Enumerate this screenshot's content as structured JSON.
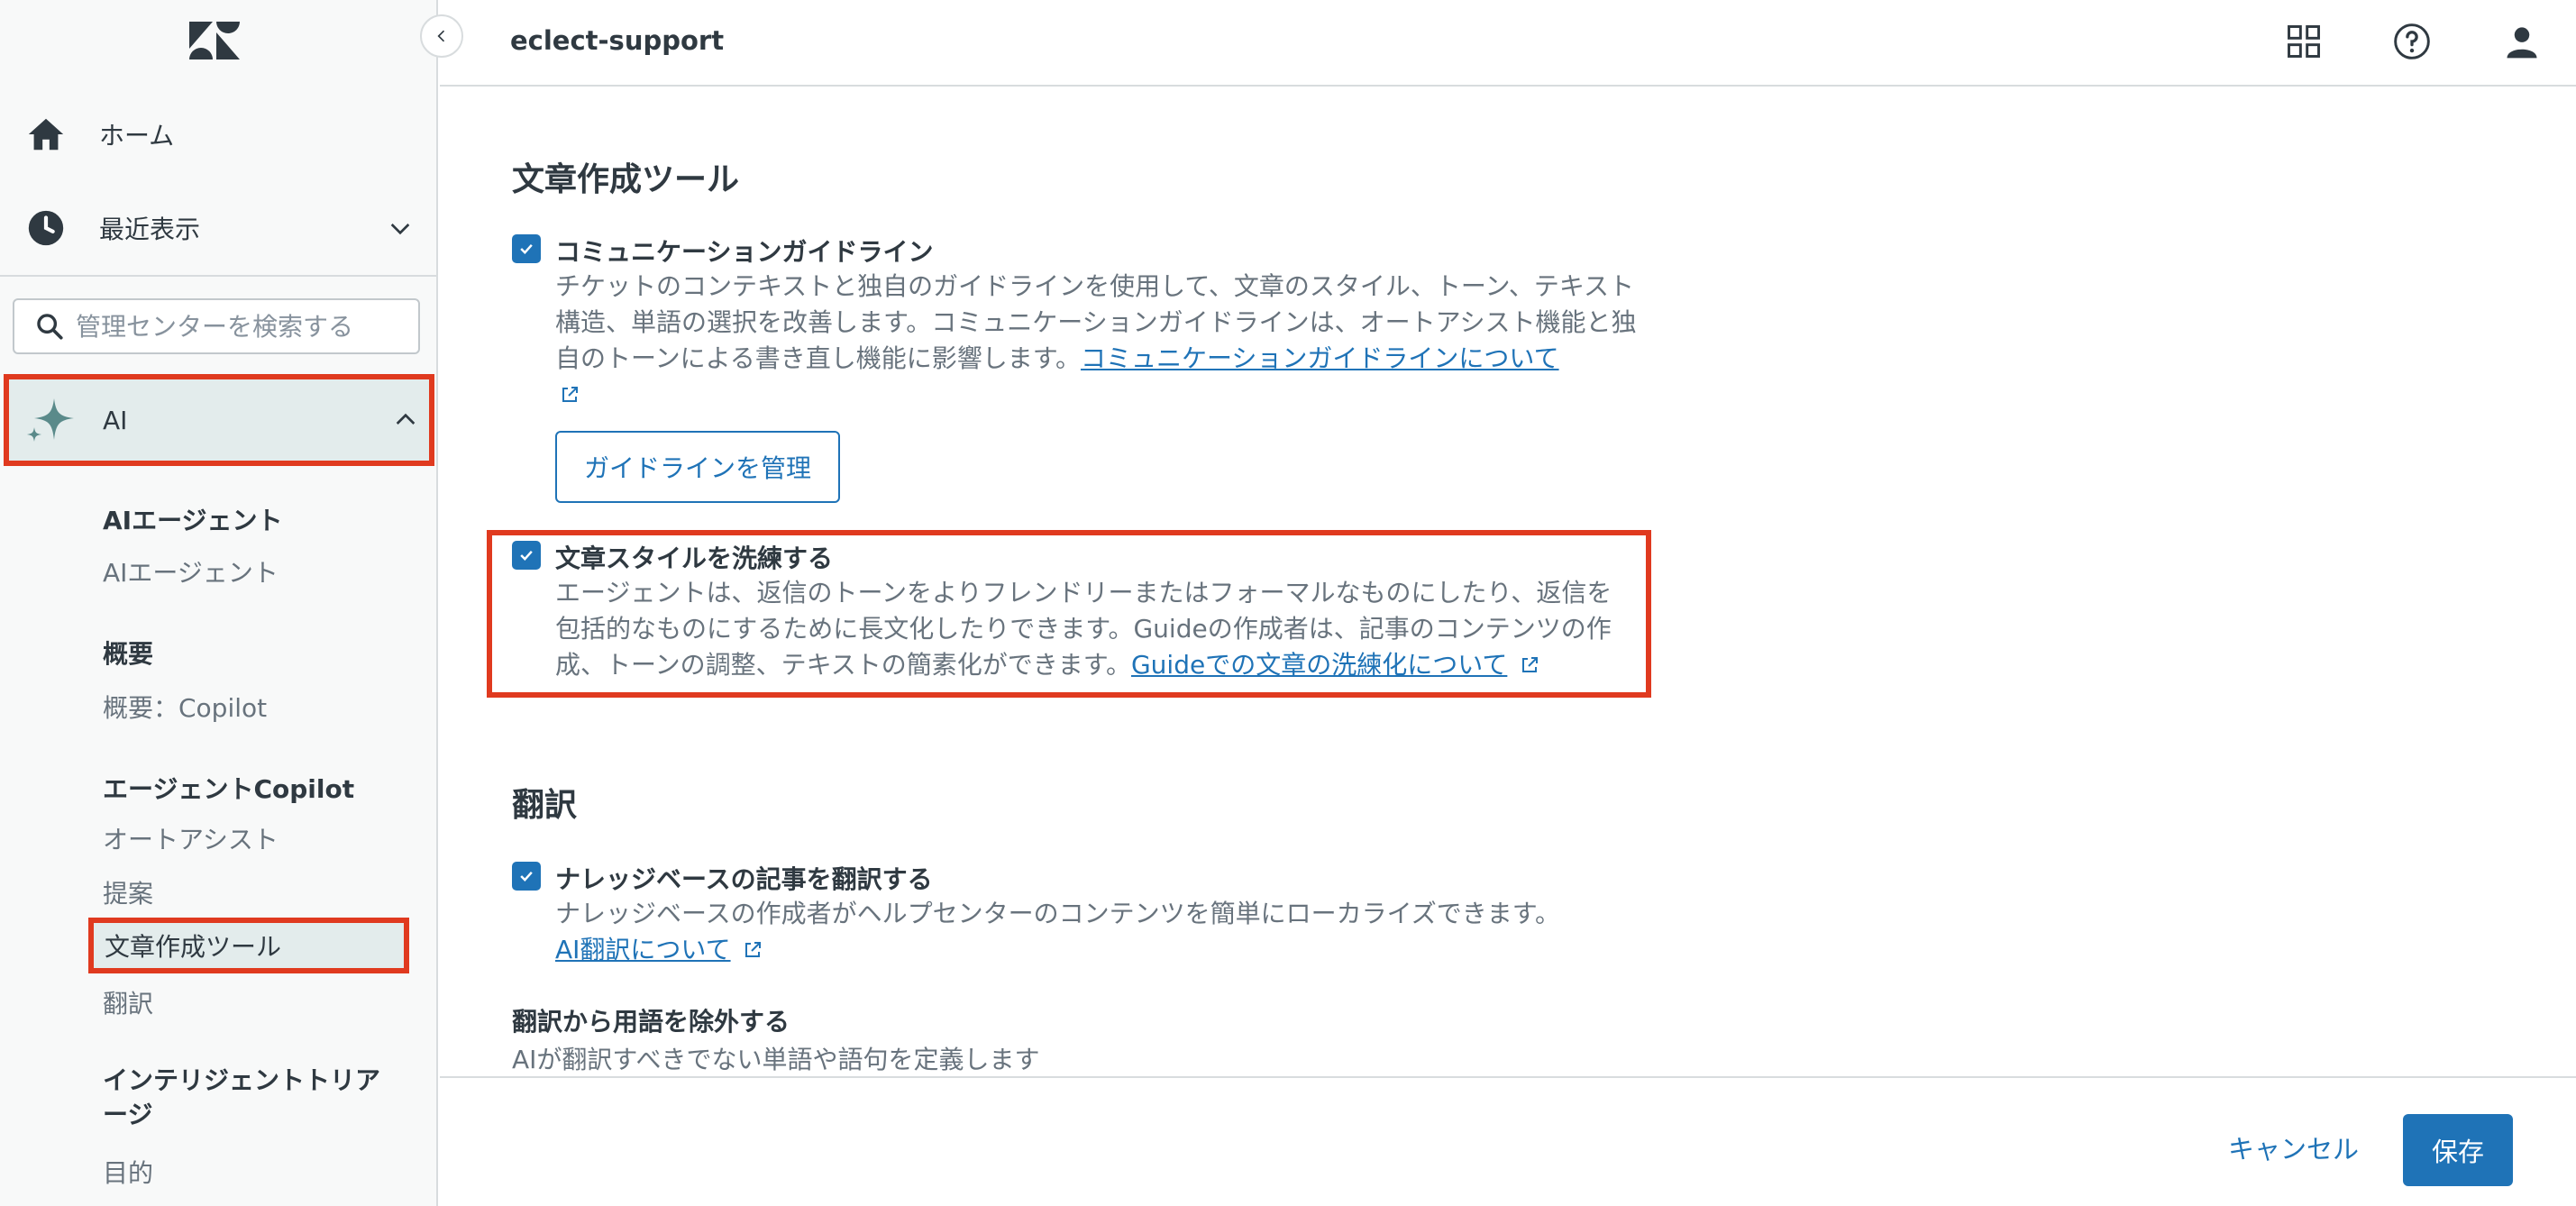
{
  "sidebar": {
    "home_label": "ホーム",
    "recent_label": "最近表示",
    "search_placeholder": "管理センターを検索する",
    "ai_label": "AI",
    "groups": [
      {
        "heading": "AIエージェント",
        "items": [
          "AIエージェント"
        ]
      },
      {
        "heading": "概要",
        "items": [
          "概要：Copilot"
        ]
      },
      {
        "heading": "エージェントCopilot",
        "items": [
          "オートアシスト",
          "提案",
          "文章作成ツール",
          "翻訳"
        ]
      },
      {
        "heading": "インテリジェントトリアージ",
        "items": [
          "目的"
        ]
      }
    ],
    "active_item": "文章作成ツール"
  },
  "header": {
    "title": "eclect-support"
  },
  "main": {
    "writing_tools": {
      "title": "文章作成ツール",
      "guidelines": {
        "title": "コミュニケーションガイドライン",
        "desc": "チケットのコンテキストと独自のガイドラインを使用して、文章のスタイル、トーン、テキスト構造、単語の選択を改善します。コミュニケーションガイドラインは、オートアシスト機能と独自のトーンによる書き直し機能に影響します。",
        "link": "コミュニケーションガイドラインについて",
        "button": "ガイドラインを管理"
      },
      "refine": {
        "title": "文章スタイルを洗練する",
        "desc": "エージェントは、返信のトーンをよりフレンドリーまたはフォーマルなものにしたり、返信を包括的なものにするために長文化したりできます。Guideの作成者は、記事のコンテンツの作成、トーンの調整、テキストの簡素化ができます。",
        "link": "Guideでの文章の洗練化について"
      }
    },
    "translation": {
      "title": "翻訳",
      "kb": {
        "title": "ナレッジベースの記事を翻訳する",
        "desc": "ナレッジベースの作成者がヘルプセンターのコンテンツを簡単にローカライズできます。",
        "link": "AI翻訳について"
      },
      "exclude": {
        "title": "翻訳から用語を除外する",
        "desc": "AIが翻訳すべきでない単語や語句を定義します"
      }
    }
  },
  "footer": {
    "cancel": "キャンセル",
    "save": "保存"
  },
  "colors": {
    "accent": "#1f73b7",
    "highlight": "#e03a1f",
    "sidebar_active": "#e3ecec"
  }
}
